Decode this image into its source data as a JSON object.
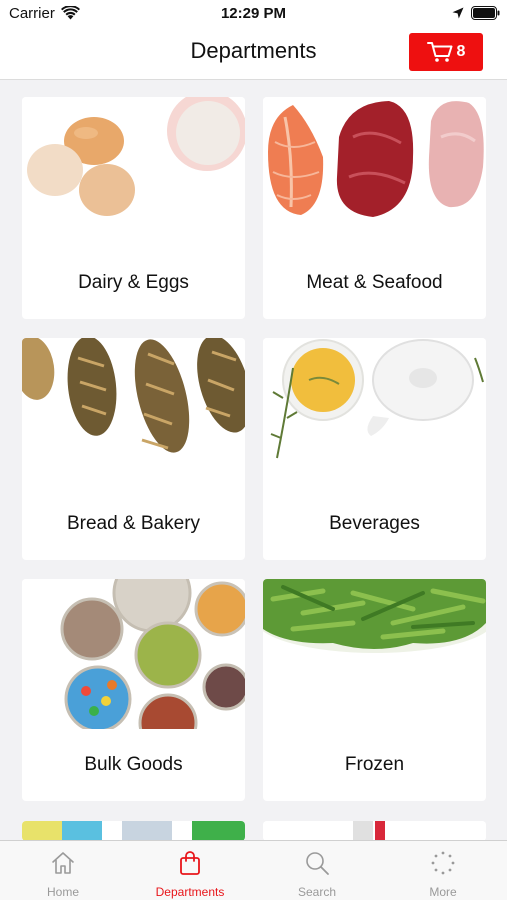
{
  "status_bar": {
    "carrier": "Carrier",
    "time": "12:29 PM"
  },
  "nav": {
    "title": "Departments",
    "cart_count": "8"
  },
  "departments": [
    {
      "label": "Dairy & Eggs",
      "image": "eggs-and-milk"
    },
    {
      "label": "Meat & Seafood",
      "image": "salmon-steak-and-poultry"
    },
    {
      "label": "Bread & Bakery",
      "image": "baguettes"
    },
    {
      "label": "Beverages",
      "image": "tea-and-teapot"
    },
    {
      "label": "Bulk Goods",
      "image": "grains-and-candy-bowls"
    },
    {
      "label": "Frozen",
      "image": "green-beans"
    }
  ],
  "tabs": [
    {
      "label": "Home",
      "icon": "home-icon",
      "active": false
    },
    {
      "label": "Departments",
      "icon": "shopping-bag-icon",
      "active": true
    },
    {
      "label": "Search",
      "icon": "search-icon",
      "active": false
    },
    {
      "label": "More",
      "icon": "more-dots-icon",
      "active": false
    }
  ],
  "colors": {
    "accent": "#ee1010",
    "inactive_tab": "#9a9a9a"
  }
}
